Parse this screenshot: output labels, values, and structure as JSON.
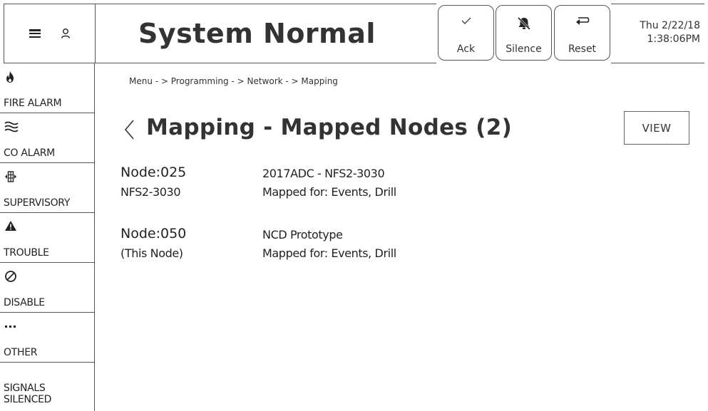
{
  "header": {
    "status_title": "System Normal",
    "buttons": {
      "ack": "Ack",
      "silence": "Silence",
      "reset": "Reset"
    },
    "clock": {
      "date": "Thu 2/22/18",
      "time": "1:38:06PM"
    }
  },
  "sidebar": {
    "items": [
      {
        "label": "FIRE ALARM",
        "icon": "flame-icon"
      },
      {
        "label": "CO ALARM",
        "icon": "waves-icon"
      },
      {
        "label": "SUPERVISORY",
        "icon": "supervisory-icon"
      },
      {
        "label": "TROUBLE",
        "icon": "warning-triangle-icon"
      },
      {
        "label": "DISABLE",
        "icon": "disable-circle-icon"
      },
      {
        "label": "OTHER",
        "icon": "dots-icon"
      },
      {
        "label": "SIGNALS\nSILENCED",
        "icon": ""
      }
    ],
    "signals_line1": "SIGNALS",
    "signals_line2": "SILENCED"
  },
  "main": {
    "breadcrumb": "Menu - > Programming - > Network - > Mapping",
    "page_title": "Mapping - Mapped Nodes (2)",
    "view_button": "VIEW",
    "nodes": [
      {
        "id": "Node:025",
        "sub": "NFS2-3030",
        "name": "2017ADC - NFS2-3030",
        "mapped": "Mapped for: Events, Drill"
      },
      {
        "id": "Node:050",
        "sub": "(This Node)",
        "name": "NCD Prototype",
        "mapped": "Mapped for: Events, Drill"
      }
    ]
  }
}
